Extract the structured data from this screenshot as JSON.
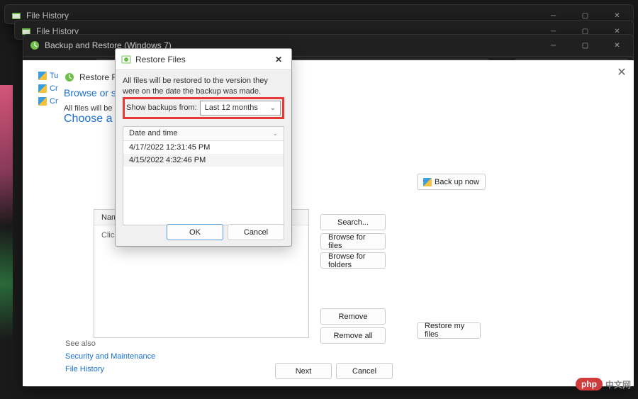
{
  "windows": {
    "fh1_title": "File History",
    "fh2_title": "File History",
    "br_title": "Backup and Restore (Windows 7)"
  },
  "panel": {
    "breadcrumb": "Restore Files",
    "heading": "Browse or se",
    "subtext": "All files will be r",
    "link": "Choose a differe",
    "box_name_header": "Name",
    "box_hint": "Click Brows",
    "backup_now": "Back up now",
    "restore_my_files": "Restore my files",
    "search": "Search...",
    "browse_files": "Browse for files",
    "browse_folders": "Browse for folders",
    "remove": "Remove",
    "remove_all": "Remove all",
    "next": "Next",
    "cancel": "Cancel",
    "sidebar": {
      "item0": "Tu",
      "item1": "Cr",
      "item2": "Cr"
    },
    "see_also": {
      "label": "See also",
      "link1": "Security and Maintenance",
      "link2": "File History"
    }
  },
  "dialog": {
    "title": "Restore Files",
    "instruction": "All files will be restored to the version they were on the date the backup was made.",
    "show_label": "Show backups from:",
    "dropdown_value": "Last 12 months",
    "list_header": "Date and time",
    "rows": {
      "r0": "4/17/2022 12:31:45 PM",
      "r1": "4/15/2022 4:32:46 PM"
    },
    "ok": "OK",
    "cancel": "Cancel"
  },
  "watermark": {
    "pill": "php",
    "cn": "中文网"
  }
}
